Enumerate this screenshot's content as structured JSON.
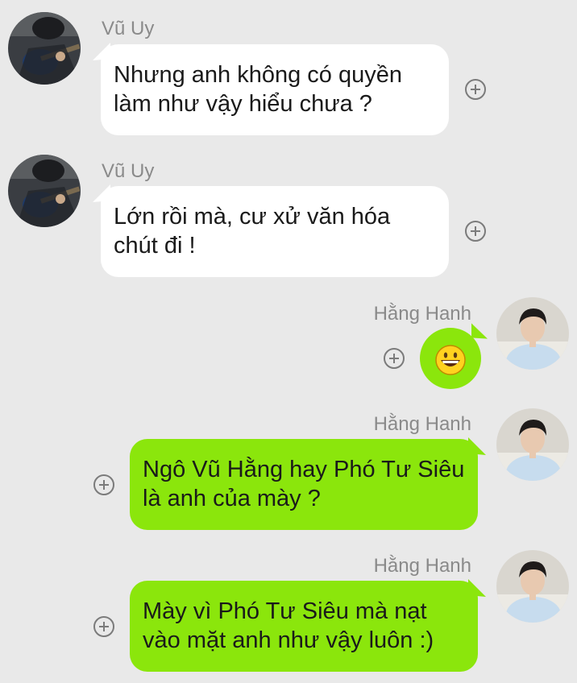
{
  "messages": [
    {
      "sender": "Vũ Uy",
      "side": "left",
      "lines": [
        "Nhưng anh không có quyền",
        "làm như vậy hiểu chưa ?"
      ]
    },
    {
      "sender": "Vũ Uy",
      "side": "left",
      "lines": [
        "Lớn rồi mà, cư xử văn hóa",
        "chút đi !"
      ]
    },
    {
      "sender": "Hằng Hanh",
      "side": "right",
      "sticker": "grinning-face-emoji"
    },
    {
      "sender": "Hằng Hanh",
      "side": "right",
      "lines": [
        "Ngô Vũ Hằng hay Phó Tư Siêu",
        "là anh của mày ?"
      ]
    },
    {
      "sender": "Hằng Hanh",
      "side": "right",
      "lines": [
        "Mày vì Phó Tư Siêu mà nạt",
        "vào mặt anh như vậy luôn :)"
      ]
    }
  ],
  "icons": {
    "reaction": "plus-circle-icon",
    "avatar_left": "guitar-player-avatar",
    "avatar_right": "young-man-avatar"
  },
  "colors": {
    "background": "#e9e9e9",
    "incoming_bubble": "#ffffff",
    "outgoing_bubble": "#8be60c",
    "sender_name": "#8a8a8a"
  }
}
